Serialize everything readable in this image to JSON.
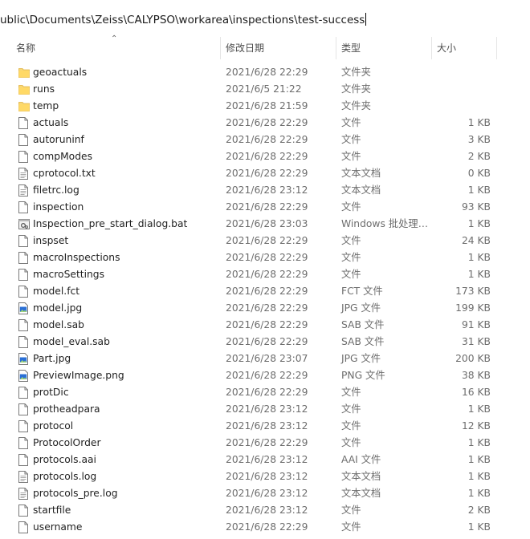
{
  "address": "ublic\\Documents\\Zeiss\\CALYPSO\\workarea\\inspections\\test-success",
  "columns": {
    "name": "名称",
    "date": "修改日期",
    "type": "类型",
    "size": "大小"
  },
  "files": [
    {
      "name": "geoactuals",
      "date": "2021/6/28 22:29",
      "type": "文件夹",
      "size": "",
      "icon": "folder-icon"
    },
    {
      "name": "runs",
      "date": "2021/6/5 21:22",
      "type": "文件夹",
      "size": "",
      "icon": "folder-icon"
    },
    {
      "name": "temp",
      "date": "2021/6/28 21:59",
      "type": "文件夹",
      "size": "",
      "icon": "folder-icon"
    },
    {
      "name": "actuals",
      "date": "2021/6/28 22:29",
      "type": "文件",
      "size": "1 KB",
      "icon": "file-icon"
    },
    {
      "name": "autoruninf",
      "date": "2021/6/28 22:29",
      "type": "文件",
      "size": "3 KB",
      "icon": "file-icon"
    },
    {
      "name": "compModes",
      "date": "2021/6/28 22:29",
      "type": "文件",
      "size": "2 KB",
      "icon": "file-icon"
    },
    {
      "name": "cprotocol.txt",
      "date": "2021/6/28 22:29",
      "type": "文本文档",
      "size": "0 KB",
      "icon": "text-file-icon"
    },
    {
      "name": "filetrc.log",
      "date": "2021/6/28 23:12",
      "type": "文本文档",
      "size": "1 KB",
      "icon": "text-file-icon"
    },
    {
      "name": "inspection",
      "date": "2021/6/28 22:29",
      "type": "文件",
      "size": "93 KB",
      "icon": "file-icon"
    },
    {
      "name": "Inspection_pre_start_dialog.bat",
      "date": "2021/6/28 23:03",
      "type": "Windows 批处理…",
      "size": "1 KB",
      "icon": "batch-file-icon"
    },
    {
      "name": "inspset",
      "date": "2021/6/28 22:29",
      "type": "文件",
      "size": "24 KB",
      "icon": "file-icon"
    },
    {
      "name": "macroInspections",
      "date": "2021/6/28 22:29",
      "type": "文件",
      "size": "1 KB",
      "icon": "file-icon"
    },
    {
      "name": "macroSettings",
      "date": "2021/6/28 22:29",
      "type": "文件",
      "size": "1 KB",
      "icon": "file-icon"
    },
    {
      "name": "model.fct",
      "date": "2021/6/28 22:29",
      "type": "FCT 文件",
      "size": "173 KB",
      "icon": "file-icon"
    },
    {
      "name": "model.jpg",
      "date": "2021/6/28 22:29",
      "type": "JPG 文件",
      "size": "199 KB",
      "icon": "image-file-icon"
    },
    {
      "name": "model.sab",
      "date": "2021/6/28 22:29",
      "type": "SAB 文件",
      "size": "91 KB",
      "icon": "file-icon"
    },
    {
      "name": "model_eval.sab",
      "date": "2021/6/28 22:29",
      "type": "SAB 文件",
      "size": "31 KB",
      "icon": "file-icon"
    },
    {
      "name": "Part.jpg",
      "date": "2021/6/28 23:07",
      "type": "JPG 文件",
      "size": "200 KB",
      "icon": "image-file-icon"
    },
    {
      "name": "PreviewImage.png",
      "date": "2021/6/28 22:29",
      "type": "PNG 文件",
      "size": "38 KB",
      "icon": "image-file-icon"
    },
    {
      "name": "protDic",
      "date": "2021/6/28 22:29",
      "type": "文件",
      "size": "16 KB",
      "icon": "file-icon"
    },
    {
      "name": "protheadpara",
      "date": "2021/6/28 23:12",
      "type": "文件",
      "size": "1 KB",
      "icon": "file-icon"
    },
    {
      "name": "protocol",
      "date": "2021/6/28 23:12",
      "type": "文件",
      "size": "12 KB",
      "icon": "file-icon"
    },
    {
      "name": "ProtocolOrder",
      "date": "2021/6/28 22:29",
      "type": "文件",
      "size": "1 KB",
      "icon": "file-icon"
    },
    {
      "name": "protocols.aai",
      "date": "2021/6/28 23:12",
      "type": "AAI 文件",
      "size": "1 KB",
      "icon": "file-icon"
    },
    {
      "name": "protocols.log",
      "date": "2021/6/28 23:12",
      "type": "文本文档",
      "size": "1 KB",
      "icon": "text-file-icon"
    },
    {
      "name": "protocols_pre.log",
      "date": "2021/6/28 23:12",
      "type": "文本文档",
      "size": "1 KB",
      "icon": "text-file-icon"
    },
    {
      "name": "startfile",
      "date": "2021/6/28 23:12",
      "type": "文件",
      "size": "2 KB",
      "icon": "file-icon"
    },
    {
      "name": "username",
      "date": "2021/6/28 22:29",
      "type": "文件",
      "size": "1 KB",
      "icon": "file-icon"
    }
  ]
}
